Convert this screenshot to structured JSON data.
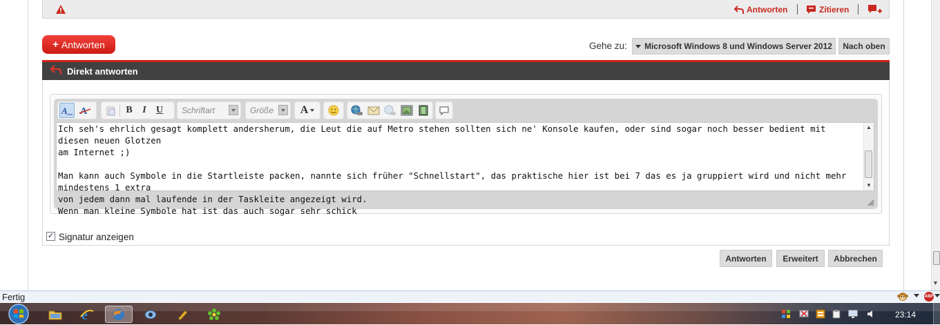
{
  "post_actions": {
    "reply": "Antworten",
    "quote": "Zitieren"
  },
  "toolbar_top": {
    "reply_button": "Antworten",
    "reply_plus": "+",
    "goto_label": "Gehe zu:",
    "goto_value": "Microsoft Windows 8 und Windows Server 2012",
    "top_button": "Nach oben"
  },
  "quick_reply": {
    "title": "Direkt antworten",
    "editor": {
      "font_select": "Schriftart",
      "size_select": "Größe",
      "bold": "B",
      "italic": "I",
      "underline": "U",
      "font_color": "A"
    },
    "text": "Ich seh's ehrlich gesagt komplett andersherum, die Leut die auf Metro stehen sollten sich ne' Konsole kaufen, oder sind sogar noch besser bedient mit diesen neuen Glotzen\nam Internet ;)\n\nMan kann auch Symbole in die Startleiste packen, nannte sich früher \"Schnellstart\", das praktische hier ist bei 7 das es ja gruppiert wird und nicht mehr mindestens 1 extra\nvon jedem dann mal laufende in der Taskleite angezeigt wird.\nWenn man kleine Symbole hat ist das auch sogar sehr schick",
    "signature_label": "Signatur anzeigen",
    "signature_checked": "✓",
    "buttons": {
      "submit": "Antworten",
      "advanced": "Erweitert",
      "cancel": "Abbrechen"
    }
  },
  "browser_status": {
    "text": "Fertig",
    "abp": "ABP"
  },
  "taskbar": {
    "clock": "23:14"
  },
  "colors": {
    "accent_red": "#d2221a",
    "panel_header": "#414141",
    "button_gray": "#dcdcdc"
  }
}
